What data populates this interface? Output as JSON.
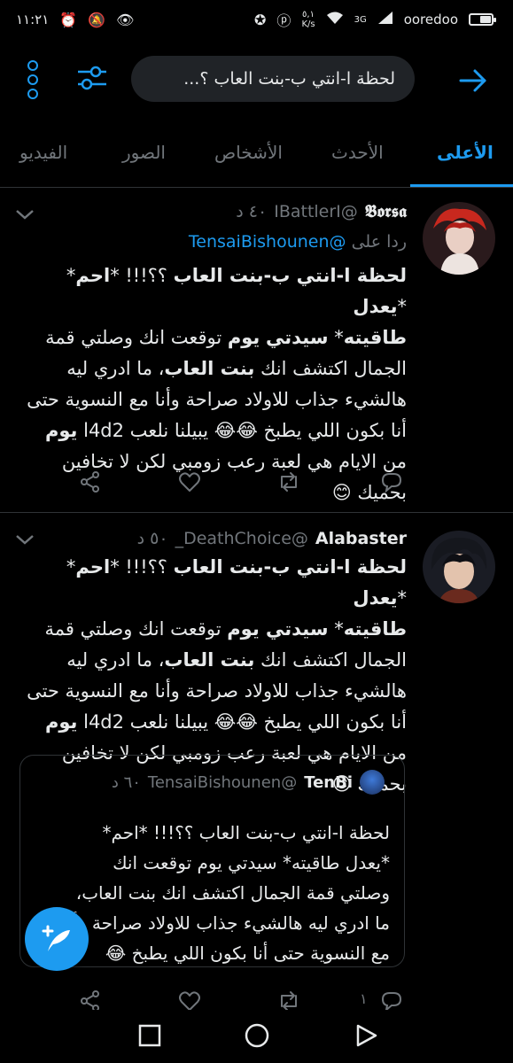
{
  "status_bar": {
    "time": "١١:٢١",
    "net_speed_value": "٥,١",
    "net_speed_unit": "K/s",
    "signal": "3G",
    "carrier": "ooredoo"
  },
  "search": {
    "query": "لحظة ا-انتي ب-بنت العاب ؟..."
  },
  "tabs": [
    {
      "label": "الأعلى",
      "active": true
    },
    {
      "label": "الأحدث",
      "active": false
    },
    {
      "label": "الأشخاص",
      "active": false
    },
    {
      "label": "الصور",
      "active": false
    },
    {
      "label": "الفيديو",
      "active": false
    }
  ],
  "tweets": [
    {
      "name": "𝕭𝖔𝖗𝖘𝖆",
      "handle": "@IBattlerI",
      "time": "٤٠ د",
      "reply_label": "ردا على",
      "reply_to": "@TensaiBishounen",
      "body_html": "<b>لحظة ا-انتي ب-بنت العاب</b> ؟؟!!!  *<b>احم</b>* *<b>يعدل</b>\n<b>طاقيته</b>* <b>سيدتي</b> <b>يوم</b> توقعت انك وصلتي قمة\nالجمال اكتشف انك <b>بنت العاب</b>، ما ادري ليه\nهالشيء جذاب للاولاد صراحة وأنا مع النسوية حتى\nأنا بكون اللي يطبخ 😂😂 يبيلنا نلعب l4d2 <b>يوم</b>\nمن الايام هي لعبة رعب زومبي لكن لا تخافين\nبحميك 😊"
    },
    {
      "name": "Alabaster",
      "handle": "@DeathChoice_",
      "time": "٥٠ د",
      "body_html": "<b>لحظة ا-انتي ب-بنت العاب</b> ؟؟!!!  *<b>احم</b>* *<b>يعدل</b>\n<b>طاقيته</b>* <b>سيدتي يوم</b> توقعت انك وصلتي قمة\nالجمال اكتشف انك <b>بنت العاب</b>، ما ادري ليه\nهالشيء جذاب للاولاد صراحة وأنا مع النسوية حتى\nأنا بكون اللي يطبخ 😂😂 يبيلنا نلعب l4d2 <b>يوم</b>\nمن الايام هي لعبة رعب زومبي لكن لا تخافين\nبحميك 😊",
      "quote": {
        "name": "TenBi",
        "handle": "@TensaiBishounen",
        "time": "٦٠ د",
        "body": "لحظة ا-انتي ب-بنت العاب ؟؟!!!  *احم*\n*يعدل طاقيته* سيدتي يوم توقعت انك\nوصلتي قمة الجمال اكتشف انك بنت العاب،\nما ادري ليه هالشيء جذاب للاولاد صراحة وأنا\nمع النسوية حتى أنا بكون اللي يطبخ 😂"
      },
      "reply_count": "١"
    }
  ],
  "colors": {
    "accent": "#1d9bf0",
    "background": "#000000",
    "muted": "#71767b",
    "divider": "#2f3336"
  }
}
